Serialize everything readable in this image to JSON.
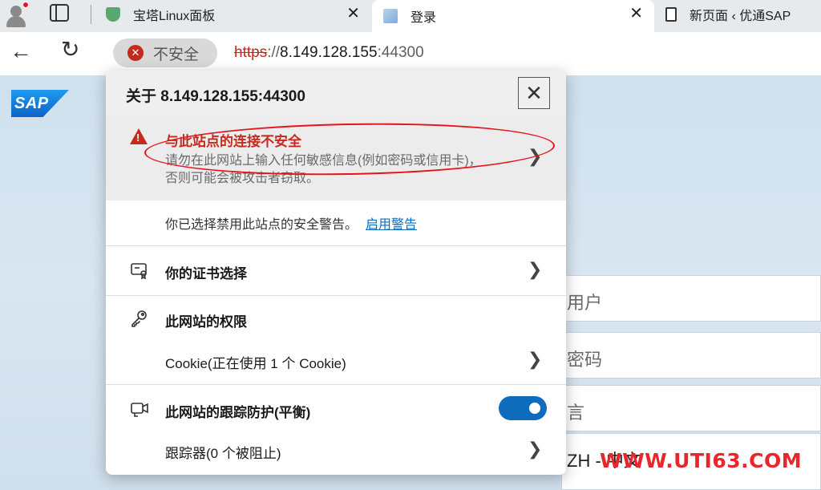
{
  "browser": {
    "tabs": [
      {
        "title": "宝塔Linux面板",
        "favicon": "shield-icon",
        "close": "✕"
      },
      {
        "title": "登录",
        "favicon": "chart-icon",
        "close": "✕"
      },
      {
        "title": "新页面 ‹ 优通SAP",
        "favicon": "document-icon"
      }
    ],
    "security_label": "不安全",
    "url": {
      "protocol": "https",
      "separator": "://",
      "host": "8.149.128.155",
      "port": ":44300"
    }
  },
  "popup": {
    "title": "关于 8.149.128.155:44300",
    "close_glyph": "✕",
    "warning": {
      "title": "与此站点的连接不安全",
      "description": "请勿在此网站上输入任何敏感信息(例如密码或信用卡)，否则可能会被攻击者窃取。"
    },
    "disabled_notice": "你已选择禁用此站点的安全警告。",
    "enable_link": "启用警告",
    "certificate": "你的证书选择",
    "permissions": "此网站的权限",
    "cookies": "Cookie(正在使用 1 个 Cookie)",
    "tracking": "此网站的跟踪防护(平衡)",
    "trackers": "跟踪器(0 个被阻止)",
    "tracking_enabled": true
  },
  "page": {
    "logo_text": "SAP",
    "user_field": "用户",
    "password_field": "密码",
    "language_label": "言",
    "language_value": "ZH - 中文"
  },
  "watermark": "WWW.UTI63.COM",
  "colors": {
    "danger": "#c42b1c",
    "link": "#0f6cbd",
    "toggle": "#0f6cbd",
    "annotation": "#e5131a"
  }
}
